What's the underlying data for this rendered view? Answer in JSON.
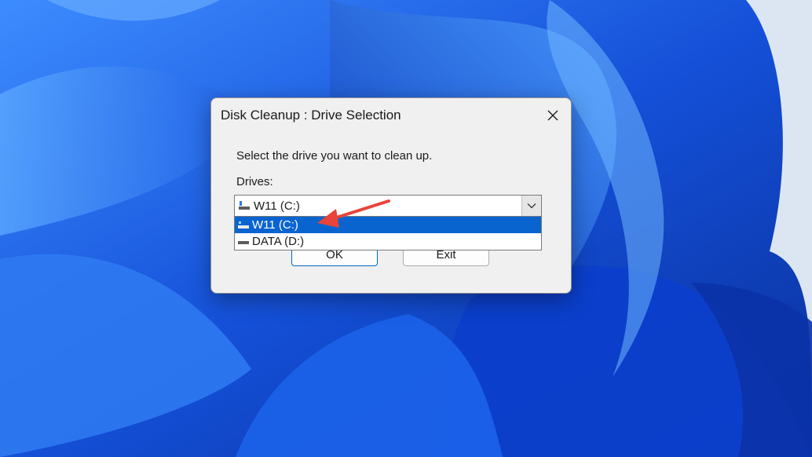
{
  "dialog": {
    "title": "Disk Cleanup : Drive Selection",
    "prompt": "Select the drive you want to clean up.",
    "drives_label": "Drives:",
    "selected_value": "W11 (C:)",
    "options": [
      {
        "label": "W11 (C:)",
        "selected": true
      },
      {
        "label": "DATA (D:)",
        "selected": false
      }
    ],
    "ok_label": "OK",
    "exit_label": "Exit"
  },
  "icons": {
    "close": "close-icon",
    "dropdown": "chevron-down-icon",
    "drive": "drive-icon",
    "annotation": "red-arrow-icon"
  },
  "colors": {
    "selection": "#0a64d0",
    "annotation_arrow": "#e8443a",
    "wallpaper_blue": "#1a5fe0",
    "wallpaper_background": "#cfdcee"
  }
}
